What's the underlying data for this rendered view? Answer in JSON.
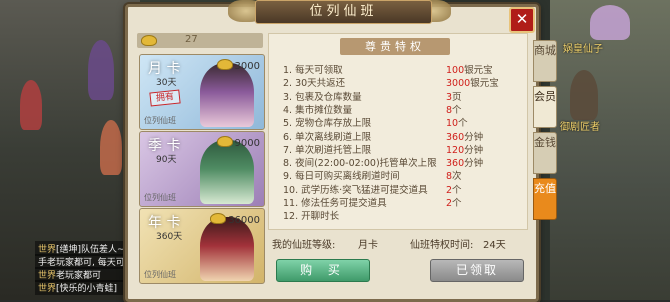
{
  "window": {
    "title": "位列仙班",
    "close_label": "✕"
  },
  "currency": {
    "icon": "gold-ingot-icon",
    "value": "27"
  },
  "cards": [
    {
      "name": "月 卡",
      "days": "30天",
      "price": "3000",
      "owned_label": "拥有",
      "footer": "位列仙班",
      "bg": "#9ec4e0",
      "figure_color": "#8a5a9a"
    },
    {
      "name": "季 卡",
      "days": "90天",
      "price": "9000",
      "owned_label": "",
      "footer": "位列仙班",
      "bg": "#b39ac4",
      "figure_color": "#4f8c63"
    },
    {
      "name": "年 卡",
      "days": "360天",
      "price": "36000",
      "owned_label": "",
      "footer": "位列仙班",
      "bg": "#e0c98a",
      "figure_color": "#a2323a"
    }
  ],
  "privileges": {
    "header": "尊贵特权",
    "rows": [
      {
        "label": "1. 每天可领取",
        "value": "100",
        "unit": "银元宝"
      },
      {
        "label": "2. 30天共返还",
        "value": "3000",
        "unit": "银元宝"
      },
      {
        "label": "3. 包裹及仓库数量",
        "value": "3",
        "unit": "页"
      },
      {
        "label": "4. 集市摊位数量",
        "value": "8",
        "unit": "个"
      },
      {
        "label": "5. 宠物仓库存放上限",
        "value": "10",
        "unit": "个"
      },
      {
        "label": "6. 单次离线刷道上限",
        "value": "360",
        "unit": "分钟"
      },
      {
        "label": "7. 单次刷道托管上限",
        "value": "120",
        "unit": "分钟"
      },
      {
        "label": "8. 夜间(22:00-02:00)托管单次上限",
        "value": "360",
        "unit": "分钟"
      },
      {
        "label": "9. 每日可购买离线刷道时间",
        "value": "8",
        "unit": "次"
      },
      {
        "label": "10. 武学历练·突飞猛进可提交道具",
        "value": "2",
        "unit": "个"
      },
      {
        "label": "11. 修法任务可提交道具",
        "value": "2",
        "unit": "个"
      },
      {
        "label": "12. 开聊时长",
        "value": "",
        "unit": ""
      }
    ]
  },
  "status": {
    "level_label": "我的仙班等级:",
    "level_value": "月卡",
    "time_label": "仙班特权时间:",
    "time_value": "24天"
  },
  "buttons": {
    "buy": "购 买",
    "received": "已领取"
  },
  "tabs": [
    {
      "label": "商城",
      "style": "normal"
    },
    {
      "label": "会员",
      "style": "active"
    },
    {
      "label": "金钱",
      "style": "normal"
    },
    {
      "label": "充值",
      "style": "orange"
    }
  ],
  "world": {
    "npc_names": [
      "娲皇仙子",
      "御剧匠者"
    ],
    "chat": [
      {
        "tag": "世界",
        "text": "[缮坤]队伍差人~"
      },
      {
        "tag": "",
        "text": "手老玩家都可, 每天可"
      },
      {
        "tag": "世界",
        "text": "老玩家都可"
      },
      {
        "tag": "世界",
        "text": "[快乐的小青蛙]"
      }
    ]
  }
}
